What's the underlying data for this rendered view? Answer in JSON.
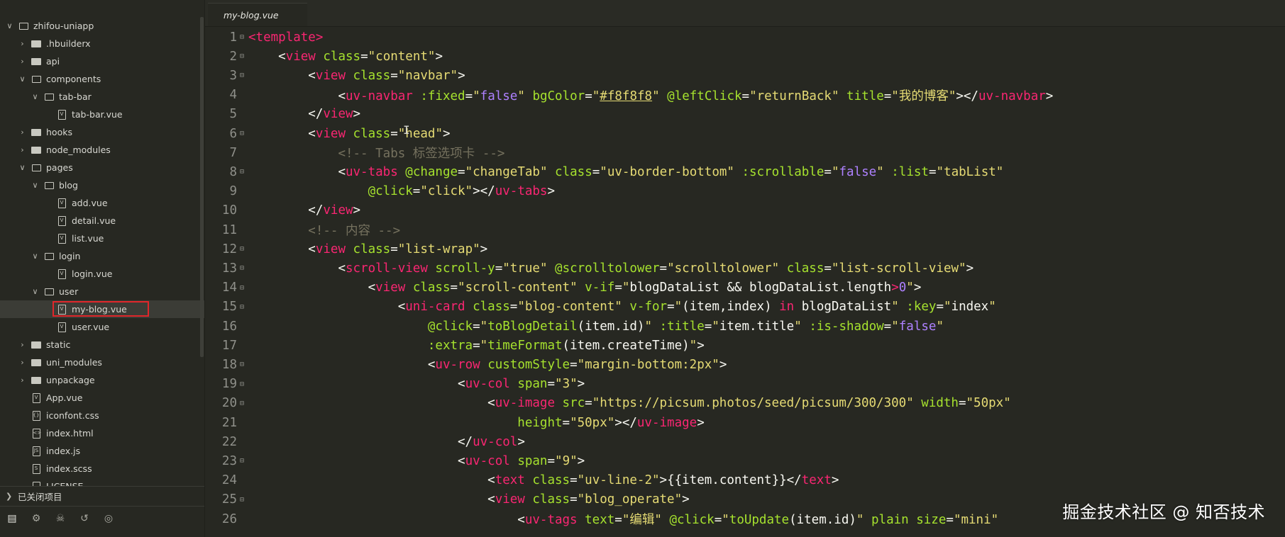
{
  "sidebar": {
    "items": [
      {
        "label": "zhifou-uniapp",
        "depth": 0,
        "kind": "project",
        "expanded": true
      },
      {
        "label": ".hbuilderx",
        "depth": 1,
        "kind": "folder",
        "expanded": false
      },
      {
        "label": "api",
        "depth": 1,
        "kind": "folder",
        "expanded": false
      },
      {
        "label": "components",
        "depth": 1,
        "kind": "folder",
        "expanded": true
      },
      {
        "label": "tab-bar",
        "depth": 2,
        "kind": "folder",
        "expanded": true
      },
      {
        "label": "tab-bar.vue",
        "depth": 3,
        "kind": "vue"
      },
      {
        "label": "hooks",
        "depth": 1,
        "kind": "folder",
        "expanded": false
      },
      {
        "label": "node_modules",
        "depth": 1,
        "kind": "folder",
        "expanded": false
      },
      {
        "label": "pages",
        "depth": 1,
        "kind": "folder",
        "expanded": true
      },
      {
        "label": "blog",
        "depth": 2,
        "kind": "folder",
        "expanded": true
      },
      {
        "label": "add.vue",
        "depth": 3,
        "kind": "vue"
      },
      {
        "label": "detail.vue",
        "depth": 3,
        "kind": "vue"
      },
      {
        "label": "list.vue",
        "depth": 3,
        "kind": "vue"
      },
      {
        "label": "login",
        "depth": 2,
        "kind": "folder",
        "expanded": true
      },
      {
        "label": "login.vue",
        "depth": 3,
        "kind": "vue"
      },
      {
        "label": "user",
        "depth": 2,
        "kind": "folder",
        "expanded": true
      },
      {
        "label": "my-blog.vue",
        "depth": 3,
        "kind": "vue",
        "selected": true
      },
      {
        "label": "user.vue",
        "depth": 3,
        "kind": "vue"
      },
      {
        "label": "static",
        "depth": 1,
        "kind": "folder",
        "expanded": false
      },
      {
        "label": "uni_modules",
        "depth": 1,
        "kind": "folder",
        "expanded": false
      },
      {
        "label": "unpackage",
        "depth": 1,
        "kind": "folder",
        "expanded": false
      },
      {
        "label": "App.vue",
        "depth": 1,
        "kind": "vue"
      },
      {
        "label": "iconfont.css",
        "depth": 1,
        "kind": "css"
      },
      {
        "label": "index.html",
        "depth": 1,
        "kind": "html"
      },
      {
        "label": "index.js",
        "depth": 1,
        "kind": "js"
      },
      {
        "label": "index.scss",
        "depth": 1,
        "kind": "scss"
      },
      {
        "label": "LICENSE",
        "depth": 1,
        "kind": "file"
      }
    ],
    "closed_projects_label": "已关闭项目",
    "toolbar_icons": [
      "project-manager-icon",
      "plugin-icon",
      "debug-icon",
      "git-icon",
      "browser-icon"
    ]
  },
  "editor": {
    "active_tab": "my-blog.vue",
    "lines": [
      [
        [
          "tag",
          "<"
        ],
        [
          "tag",
          "template"
        ],
        [
          "tag",
          ">"
        ]
      ],
      [
        [
          "ws",
          "    "
        ],
        [
          "pl",
          "<"
        ],
        [
          "tag",
          "view "
        ],
        [
          "attr",
          "class"
        ],
        [
          "pl",
          "="
        ],
        [
          "str",
          "\"content\""
        ],
        [
          "pl",
          ">"
        ]
      ],
      [
        [
          "ws",
          "        "
        ],
        [
          "pl",
          "<"
        ],
        [
          "tag",
          "view "
        ],
        [
          "attr",
          "class"
        ],
        [
          "pl",
          "="
        ],
        [
          "str",
          "\"navbar\""
        ],
        [
          "pl",
          ">"
        ]
      ],
      [
        [
          "ws",
          "            "
        ],
        [
          "pl",
          "<"
        ],
        [
          "tag",
          "uv-navbar "
        ],
        [
          "attr",
          ":fixed"
        ],
        [
          "pl",
          "="
        ],
        [
          "str",
          "\""
        ],
        [
          "kw",
          "false"
        ],
        [
          "str",
          "\""
        ],
        [
          "pl",
          " "
        ],
        [
          "attr",
          "bgColor"
        ],
        [
          "pl",
          "="
        ],
        [
          "str",
          "\""
        ],
        [
          "ul",
          "#f8f8f8"
        ],
        [
          "str",
          "\""
        ],
        [
          "pl",
          " "
        ],
        [
          "attr",
          "@leftClick"
        ],
        [
          "pl",
          "="
        ],
        [
          "str",
          "\"returnBack\""
        ],
        [
          "pl",
          " "
        ],
        [
          "attr",
          "title"
        ],
        [
          "pl",
          "="
        ],
        [
          "str",
          "\"我的博客\""
        ],
        [
          "pl",
          "></"
        ],
        [
          "tag",
          "uv-navbar"
        ],
        [
          "pl",
          ">"
        ]
      ],
      [
        [
          "ws",
          "        "
        ],
        [
          "pl",
          "</"
        ],
        [
          "tag",
          "view"
        ],
        [
          "pl",
          ">"
        ]
      ],
      [
        [
          "ws",
          "        "
        ],
        [
          "pl",
          "<"
        ],
        [
          "tag",
          "view "
        ],
        [
          "attr",
          "class"
        ],
        [
          "pl",
          "="
        ],
        [
          "str",
          "\"head\""
        ],
        [
          "pl",
          ">"
        ]
      ],
      [
        [
          "ws",
          "            "
        ],
        [
          "cmt",
          "<!-- Tabs 标签选项卡 -->"
        ]
      ],
      [
        [
          "ws",
          "            "
        ],
        [
          "pl",
          "<"
        ],
        [
          "tag",
          "uv-tabs "
        ],
        [
          "attr",
          "@change"
        ],
        [
          "pl",
          "="
        ],
        [
          "str",
          "\"changeTab\""
        ],
        [
          "pl",
          " "
        ],
        [
          "attr",
          "class"
        ],
        [
          "pl",
          "="
        ],
        [
          "str",
          "\"uv-border-bottom\""
        ],
        [
          "pl",
          " "
        ],
        [
          "attr",
          ":scrollable"
        ],
        [
          "pl",
          "="
        ],
        [
          "str",
          "\""
        ],
        [
          "kw",
          "false"
        ],
        [
          "str",
          "\""
        ],
        [
          "pl",
          " "
        ],
        [
          "attr",
          ":list"
        ],
        [
          "pl",
          "="
        ],
        [
          "str",
          "\"tabList\""
        ]
      ],
      [
        [
          "ws",
          "                "
        ],
        [
          "attr",
          "@click"
        ],
        [
          "pl",
          "="
        ],
        [
          "str",
          "\"click\""
        ],
        [
          "pl",
          "></"
        ],
        [
          "tag",
          "uv-tabs"
        ],
        [
          "pl",
          ">"
        ]
      ],
      [
        [
          "ws",
          "        "
        ],
        [
          "pl",
          "</"
        ],
        [
          "tag",
          "view"
        ],
        [
          "pl",
          ">"
        ]
      ],
      [
        [
          "ws",
          "        "
        ],
        [
          "cmt",
          "<!-- 内容 -->"
        ]
      ],
      [
        [
          "ws",
          "        "
        ],
        [
          "pl",
          "<"
        ],
        [
          "tag",
          "view "
        ],
        [
          "attr",
          "class"
        ],
        [
          "pl",
          "="
        ],
        [
          "str",
          "\"list-wrap\""
        ],
        [
          "pl",
          ">"
        ]
      ],
      [
        [
          "ws",
          "            "
        ],
        [
          "pl",
          "<"
        ],
        [
          "tag",
          "scroll-view "
        ],
        [
          "attr",
          "scroll-y"
        ],
        [
          "pl",
          "="
        ],
        [
          "str",
          "\"true\""
        ],
        [
          "pl",
          " "
        ],
        [
          "attr",
          "@scrolltolower"
        ],
        [
          "pl",
          "="
        ],
        [
          "str",
          "\"scrolltolower\""
        ],
        [
          "pl",
          " "
        ],
        [
          "attr",
          "class"
        ],
        [
          "pl",
          "="
        ],
        [
          "str",
          "\"list-scroll-view\""
        ],
        [
          "pl",
          ">"
        ]
      ],
      [
        [
          "ws",
          "                "
        ],
        [
          "pl",
          "<"
        ],
        [
          "tag",
          "view "
        ],
        [
          "attr",
          "class"
        ],
        [
          "pl",
          "="
        ],
        [
          "str",
          "\"scroll-content\""
        ],
        [
          "pl",
          " "
        ],
        [
          "attr",
          "v-if"
        ],
        [
          "pl",
          "="
        ],
        [
          "str",
          "\""
        ],
        [
          "pl",
          "blogDataList && blogDataList.length"
        ],
        [
          "tag",
          ">"
        ],
        [
          "kw",
          "0"
        ],
        [
          "str",
          "\""
        ],
        [
          "pl",
          ">"
        ]
      ],
      [
        [
          "ws",
          "                    "
        ],
        [
          "pl",
          "<"
        ],
        [
          "tag",
          "uni-card "
        ],
        [
          "attr",
          "class"
        ],
        [
          "pl",
          "="
        ],
        [
          "str",
          "\"blog-content\""
        ],
        [
          "pl",
          " "
        ],
        [
          "attr",
          "v-for"
        ],
        [
          "pl",
          "="
        ],
        [
          "str",
          "\""
        ],
        [
          "pl",
          "(item,index) "
        ],
        [
          "tag",
          "in"
        ],
        [
          "pl",
          " blogDataList"
        ],
        [
          "str",
          "\""
        ],
        [
          "pl",
          " "
        ],
        [
          "attr",
          ":key"
        ],
        [
          "pl",
          "="
        ],
        [
          "str",
          "\""
        ],
        [
          "pl",
          "index"
        ],
        [
          "str",
          "\""
        ]
      ],
      [
        [
          "ws",
          "                        "
        ],
        [
          "attr",
          "@click"
        ],
        [
          "pl",
          "="
        ],
        [
          "str",
          "\""
        ],
        [
          "attr",
          "toBlogDetail"
        ],
        [
          "pl",
          "(item.id)"
        ],
        [
          "str",
          "\""
        ],
        [
          "pl",
          " "
        ],
        [
          "attr",
          ":title"
        ],
        [
          "pl",
          "="
        ],
        [
          "str",
          "\""
        ],
        [
          "pl",
          "item.title"
        ],
        [
          "str",
          "\""
        ],
        [
          "pl",
          " "
        ],
        [
          "attr",
          ":is-shadow"
        ],
        [
          "pl",
          "="
        ],
        [
          "str",
          "\""
        ],
        [
          "kw",
          "false"
        ],
        [
          "str",
          "\""
        ]
      ],
      [
        [
          "ws",
          "                        "
        ],
        [
          "attr",
          ":extra"
        ],
        [
          "pl",
          "="
        ],
        [
          "str",
          "\""
        ],
        [
          "attr",
          "timeFormat"
        ],
        [
          "pl",
          "(item.createTime)"
        ],
        [
          "str",
          "\""
        ],
        [
          "pl",
          ">"
        ]
      ],
      [
        [
          "ws",
          "                        "
        ],
        [
          "pl",
          "<"
        ],
        [
          "tag",
          "uv-row "
        ],
        [
          "attr",
          "customStyle"
        ],
        [
          "pl",
          "="
        ],
        [
          "str",
          "\"margin-bottom:2px\""
        ],
        [
          "pl",
          ">"
        ]
      ],
      [
        [
          "ws",
          "                            "
        ],
        [
          "pl",
          "<"
        ],
        [
          "tag",
          "uv-col "
        ],
        [
          "attr",
          "span"
        ],
        [
          "pl",
          "="
        ],
        [
          "str",
          "\"3\""
        ],
        [
          "pl",
          ">"
        ]
      ],
      [
        [
          "ws",
          "                                "
        ],
        [
          "pl",
          "<"
        ],
        [
          "tag",
          "uv-image "
        ],
        [
          "attr",
          "src"
        ],
        [
          "pl",
          "="
        ],
        [
          "str",
          "\"https://picsum.photos/seed/picsum/300/300\""
        ],
        [
          "pl",
          " "
        ],
        [
          "attr",
          "width"
        ],
        [
          "pl",
          "="
        ],
        [
          "str",
          "\"50px\""
        ]
      ],
      [
        [
          "ws",
          "                                    "
        ],
        [
          "attr",
          "height"
        ],
        [
          "pl",
          "="
        ],
        [
          "str",
          "\"50px\""
        ],
        [
          "pl",
          "></"
        ],
        [
          "tag",
          "uv-image"
        ],
        [
          "pl",
          ">"
        ]
      ],
      [
        [
          "ws",
          "                            "
        ],
        [
          "pl",
          "</"
        ],
        [
          "tag",
          "uv-col"
        ],
        [
          "pl",
          ">"
        ]
      ],
      [
        [
          "ws",
          "                            "
        ],
        [
          "pl",
          "<"
        ],
        [
          "tag",
          "uv-col "
        ],
        [
          "attr",
          "span"
        ],
        [
          "pl",
          "="
        ],
        [
          "str",
          "\"9\""
        ],
        [
          "pl",
          ">"
        ]
      ],
      [
        [
          "ws",
          "                                "
        ],
        [
          "pl",
          "<"
        ],
        [
          "tag",
          "text "
        ],
        [
          "attr",
          "class"
        ],
        [
          "pl",
          "="
        ],
        [
          "str",
          "\"uv-line-2\""
        ],
        [
          "pl",
          ">{{item.content}}</"
        ],
        [
          "tag",
          "text"
        ],
        [
          "pl",
          ">"
        ]
      ],
      [
        [
          "ws",
          "                                "
        ],
        [
          "pl",
          "<"
        ],
        [
          "tag",
          "view "
        ],
        [
          "attr",
          "class"
        ],
        [
          "pl",
          "="
        ],
        [
          "str",
          "\"blog_operate\""
        ],
        [
          "pl",
          ">"
        ]
      ],
      [
        [
          "ws",
          "                                    "
        ],
        [
          "pl",
          "<"
        ],
        [
          "tag",
          "uv-tags "
        ],
        [
          "attr",
          "text"
        ],
        [
          "pl",
          "="
        ],
        [
          "str",
          "\"编辑\""
        ],
        [
          "pl",
          " "
        ],
        [
          "attr",
          "@click"
        ],
        [
          "pl",
          "="
        ],
        [
          "str",
          "\""
        ],
        [
          "attr",
          "toUpdate"
        ],
        [
          "pl",
          "(item.id)"
        ],
        [
          "str",
          "\""
        ],
        [
          "pl",
          " "
        ],
        [
          "attr",
          "plain"
        ],
        [
          "pl",
          " "
        ],
        [
          "attr",
          "size"
        ],
        [
          "pl",
          "="
        ],
        [
          "str",
          "\"mini\""
        ]
      ]
    ]
  },
  "watermark": "掘金技术社区 @ 知否技术",
  "colors": {
    "background": "#272822",
    "tag": "#f92672",
    "attr": "#a6e22e",
    "string": "#e6db74",
    "keyword": "#ae81ff",
    "comment": "#75715e",
    "selection_box": "#e0262a"
  }
}
